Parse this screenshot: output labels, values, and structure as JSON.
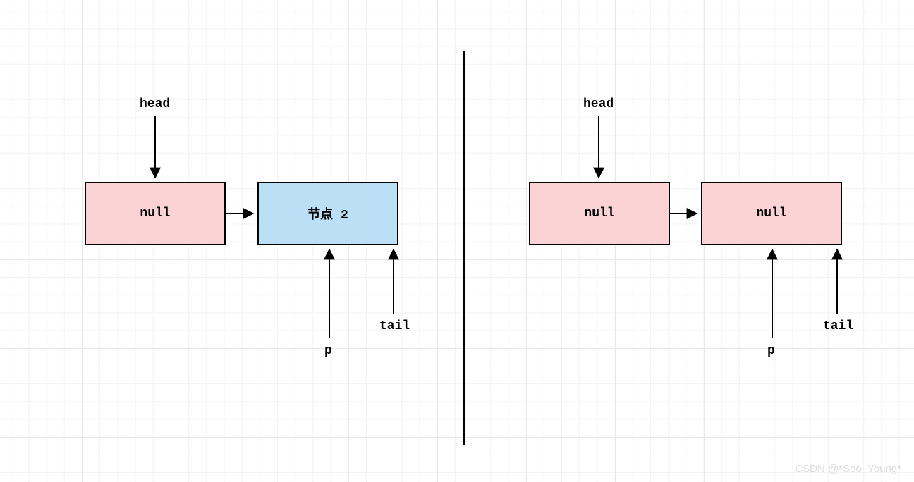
{
  "left": {
    "head_label": "head",
    "node1": "null",
    "node2": "节点 2",
    "p_label": "p",
    "tail_label": "tail"
  },
  "right": {
    "head_label": "head",
    "node1": "null",
    "node2": "null",
    "p_label": "p",
    "tail_label": "tail"
  },
  "watermark": "CSDN @*Soo_Young*",
  "colors": {
    "pink": "#fbd3d4",
    "blue": "#bbdff5",
    "border": "#000000"
  }
}
